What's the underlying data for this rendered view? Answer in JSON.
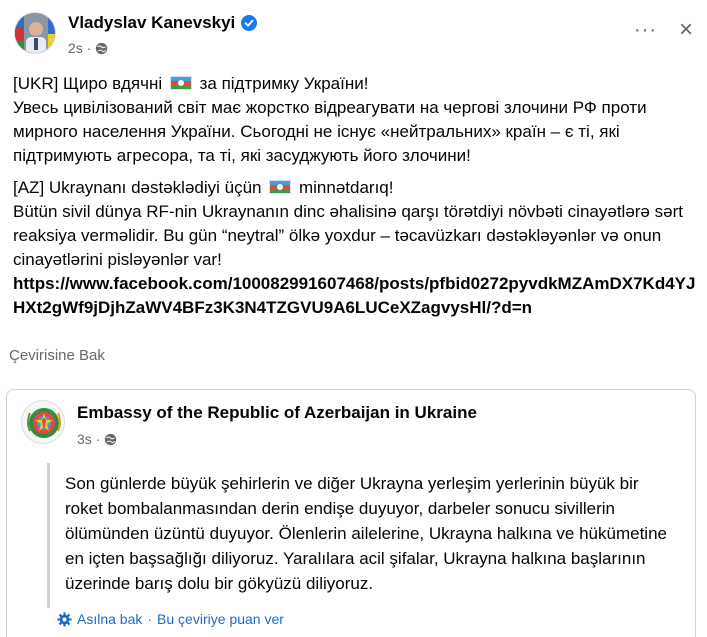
{
  "author": {
    "name": "Vladyslav Kanevskyi",
    "timestamp": "2s",
    "separator": "·",
    "verified_icon": "verified-badge-icon",
    "audience_icon": "globe-icon"
  },
  "header_actions": {
    "more": "···",
    "close": "×"
  },
  "post": {
    "ukr_p1_pre": "[UKR] Щиро вдячні",
    "ukr_p1_post": "за підтримку України!",
    "ukr_p2": "Увесь цивілізований світ має жорстко відреагувати на чергові злочини РФ проти мирного населення України. Сьогодні не існує «нейтральних» країн – є ті, які підтримують агресора, та ті, які засуджують його злочини!",
    "az_p1_pre": "[AZ] Ukraynanı dəstəklədiyi  üçün",
    "az_p1_post": "minnətdarıq!",
    "az_p2": "Bütün sivil dünya RF-nin  Ukraynanın dinc əhalisinə qarşı törətdiyi növbəti cinayətlərə sərt reaksiya verməlidir. Bu gün “neytral” ölkə yoxdur – təcavüzkarı dəstəkləyənlər və onun cinayətlərini pisləyənlər  var!",
    "link": "https://www.facebook.com/100082991607468/posts/pfbid0272pyvdkMZAmDX7Kd4YJHXt2gWf9jDjhZaWV4BFz3K3N4TZGVU9A6LUCeXZagvysHl/?d=n",
    "flag_icon": "azerbaijan-flag-icon"
  },
  "see_translation": "Çevirisine Bak",
  "shared": {
    "page_name": "Embassy of the Republic of Azerbaijan in Ukraine",
    "timestamp": "3s",
    "separator": "·",
    "quote": "Son günlerde büyük şehirlerin ve diğer Ukrayna yerleşim yerlerinin büyük bir roket bombalanmasından derin endişe duyuyor, darbeler sonucu sivillerin ölümünden üzüntü duyuyor. Ölenlerin ailelerine, Ukrayna halkına ve hükümetine en içten başsağlığı diliyoruz. Yaralılara acil şifalar, Ukrayna halkına başlarının üzerinde barış dolu bir gökyüzü diliyoruz.",
    "see_original": "Asıl­na bak",
    "rate_translation": "Bu çeviriye puan ver",
    "separator2": "·"
  },
  "colors": {
    "link_blue": "#1b6ac9",
    "meta_gray": "#65676b",
    "verified_blue": "#1877f2"
  }
}
